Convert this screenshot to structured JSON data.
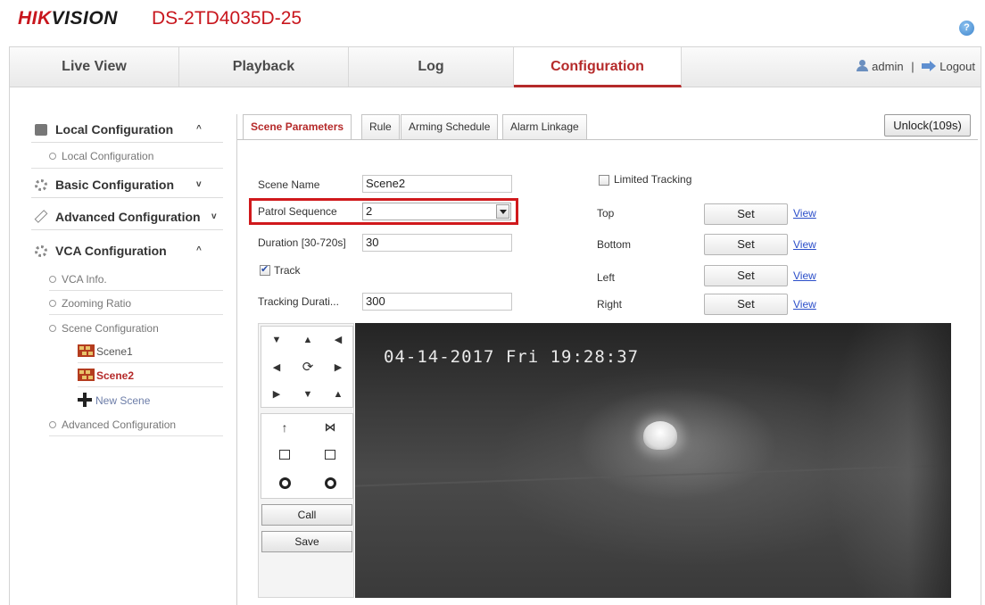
{
  "header": {
    "logo_red": "HIK",
    "logo_black": "VISION",
    "model": "DS-2TD4035D-25",
    "help_symbol": "?"
  },
  "nav": {
    "tabs": [
      {
        "label": "Live View"
      },
      {
        "label": "Playback"
      },
      {
        "label": "Log"
      },
      {
        "label": "Configuration",
        "active": true
      }
    ],
    "user": "admin",
    "separator": "|",
    "logout": "Logout"
  },
  "sidebar": {
    "local": {
      "title": "Local Configuration",
      "chevron": "^",
      "items": [
        "Local Configuration"
      ]
    },
    "basic": {
      "title": "Basic Configuration",
      "chevron": "v"
    },
    "advanced": {
      "title": "Advanced Configuration",
      "chevron": "v"
    },
    "vca": {
      "title": "VCA Configuration",
      "chevron": "^",
      "items": [
        "VCA Info.",
        "Zooming Ratio",
        "Scene Configuration"
      ],
      "scenes": [
        "Scene1",
        "Scene2"
      ],
      "active_scene": "Scene2",
      "new_scene": "New Scene",
      "advanced": "Advanced Configuration"
    }
  },
  "tabs": [
    {
      "label": "Scene Parameters",
      "active": true
    },
    {
      "label": "Rule"
    },
    {
      "label": "Arming Schedule"
    },
    {
      "label": "Alarm Linkage"
    }
  ],
  "unlock": "Unlock(109s)",
  "form": {
    "scene_name": {
      "label": "Scene Name",
      "value": "Scene2"
    },
    "patrol": {
      "label": "Patrol Sequence",
      "value": "2"
    },
    "duration": {
      "label": "Duration [30-720s]",
      "value": "30"
    },
    "track": {
      "label": "Track",
      "checked": true
    },
    "tracking_duration": {
      "label": "Tracking Durati...",
      "value": "300"
    },
    "limited_tracking": {
      "label": "Limited Tracking",
      "checked": false
    },
    "limits": [
      {
        "label": "Top",
        "button": "Set",
        "link": "View"
      },
      {
        "label": "Bottom",
        "button": "Set",
        "link": "View"
      },
      {
        "label": "Left",
        "button": "Set",
        "link": "View"
      },
      {
        "label": "Right",
        "button": "Set",
        "link": "View"
      }
    ]
  },
  "ptz": {
    "call": "Call",
    "save": "Save"
  },
  "video": {
    "timestamp": "04-14-2017 Fri 19:28:37"
  },
  "colors": {
    "brand_red": "#c8161d",
    "active_tab": "#b52a2a",
    "highlight": "#d0191c",
    "link": "#2b4ec9"
  }
}
